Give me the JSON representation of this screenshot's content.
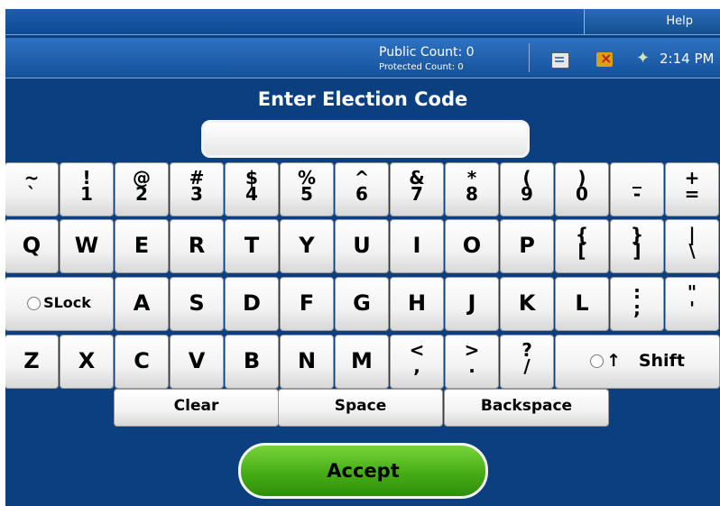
{
  "help_label": "Help",
  "status": {
    "public_count": "Public Count: 0",
    "protected_count": "Protected Count: 0",
    "time": "2:14 PM"
  },
  "title": "Enter Election Code",
  "code_value": "",
  "keyboard": {
    "row1": [
      {
        "top": "~",
        "bottom": "`"
      },
      {
        "top": "!",
        "bottom": "1"
      },
      {
        "top": "@",
        "bottom": "2"
      },
      {
        "top": "#",
        "bottom": "3"
      },
      {
        "top": "$",
        "bottom": "4"
      },
      {
        "top": "%",
        "bottom": "5"
      },
      {
        "top": "^",
        "bottom": "6"
      },
      {
        "top": "&",
        "bottom": "7"
      },
      {
        "top": "*",
        "bottom": "8"
      },
      {
        "top": "(",
        "bottom": "9"
      },
      {
        "top": ")",
        "bottom": "0"
      },
      {
        "top": "_",
        "bottom": "-"
      },
      {
        "top": "+",
        "bottom": "="
      }
    ],
    "row2": [
      {
        "label": "Q"
      },
      {
        "label": "W"
      },
      {
        "label": "E"
      },
      {
        "label": "R"
      },
      {
        "label": "T"
      },
      {
        "label": "Y"
      },
      {
        "label": "U"
      },
      {
        "label": "I"
      },
      {
        "label": "O"
      },
      {
        "label": "P"
      },
      {
        "top": "{",
        "bottom": "["
      },
      {
        "top": "}",
        "bottom": "]"
      },
      {
        "top": "|",
        "bottom": "\\"
      }
    ],
    "row3": [
      {
        "label": "A"
      },
      {
        "label": "S"
      },
      {
        "label": "D"
      },
      {
        "label": "F"
      },
      {
        "label": "G"
      },
      {
        "label": "H"
      },
      {
        "label": "J"
      },
      {
        "label": "K"
      },
      {
        "label": "L"
      },
      {
        "top": ":",
        "bottom": ";"
      },
      {
        "top": "\"",
        "bottom": "'"
      }
    ],
    "row4": [
      {
        "label": "Z"
      },
      {
        "label": "X"
      },
      {
        "label": "C"
      },
      {
        "label": "V"
      },
      {
        "label": "B"
      },
      {
        "label": "N"
      },
      {
        "label": "M"
      },
      {
        "top": "<",
        "bottom": ","
      },
      {
        "top": ">",
        "bottom": "."
      },
      {
        "top": "?",
        "bottom": "/"
      }
    ],
    "slock_label": "SLock",
    "shift_label": "Shift",
    "shift_arrow": "↑",
    "clear_label": "Clear",
    "space_label": "Space",
    "backspace_label": "Backspace"
  },
  "accept_label": "Accept",
  "colors": {
    "background": "#0b3f7f",
    "accept": "#46ad16"
  },
  "icons": [
    "document-icon",
    "card-error-icon",
    "plug-icon",
    "radio-icon",
    "shift-arrow-icon"
  ]
}
